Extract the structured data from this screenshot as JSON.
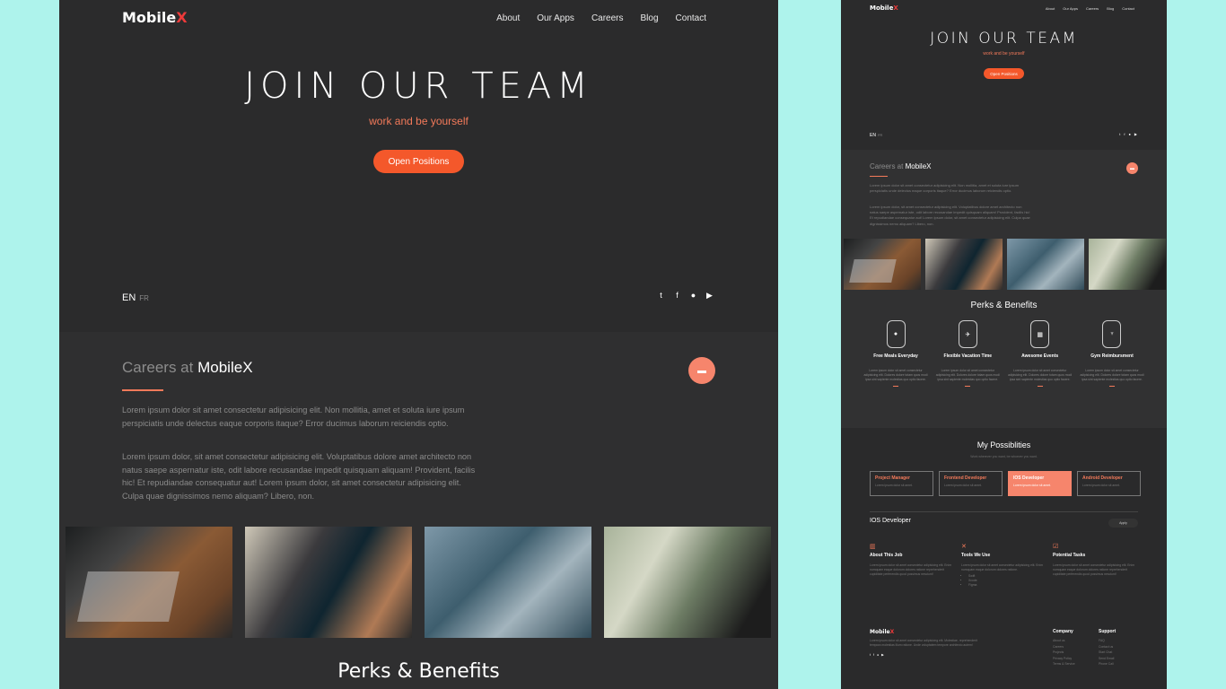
{
  "brand": {
    "name": "Mobile",
    "accent": "X",
    "accent_color": "#ee3a3a"
  },
  "colors": {
    "primary": "#f4582b",
    "soft": "#f6856c",
    "bg": "#2a2a2b",
    "page_bg": "#aef3ec"
  },
  "nav": [
    "About",
    "Our Apps",
    "Careers",
    "Blog",
    "Contact"
  ],
  "hero": {
    "title": "JOIN OUR TEAM",
    "subtitle": "work and be yourself",
    "button": "Open Positions"
  },
  "lang": {
    "active": "EN",
    "other": "FR"
  },
  "social": [
    {
      "icon": "twitter-icon",
      "glyph": "🐦"
    },
    {
      "icon": "facebook-icon",
      "glyph": "f"
    },
    {
      "icon": "apple-icon",
      "glyph": ""
    },
    {
      "icon": "play-store-icon",
      "glyph": "▶"
    }
  ],
  "careers": {
    "heading_prefix": "Careers at",
    "heading_brand": "MobileX",
    "p1": "Lorem ipsum dolor sit amet consectetur adipisicing elit. Non mollitia, amet et soluta iure ipsum perspiciatis unde delectus eaque corporis itaque? Error ducimus laborum reiciendis optio.",
    "p2": "Lorem ipsum dolor, sit amet consectetur adipisicing elit. Voluptatibus dolore amet architecto non natus saepe aspernatur iste, odit labore recusandae impedit quisquam aliquam! Provident, facilis hic! Et repudiandae consequatur aut! Lorem ipsum dolor, sit amet consectetur adipisicing elit. Culpa quae dignissimos nemo aliquam? Libero, non.",
    "photos": [
      "laptop-coffee-photo",
      "phone-laptop-photo",
      "typing-laptop-photo",
      "man-phone-photo"
    ]
  },
  "perks": {
    "title": "Perks & Benefits",
    "items": [
      {
        "icon": "apple-icon",
        "glyph": "",
        "title": "Free Meals Everyday"
      },
      {
        "icon": "vacation-icon",
        "glyph": "✈",
        "title": "Flexible Vacation Time"
      },
      {
        "icon": "calendar-icon",
        "glyph": "▦",
        "title": "Awesome Events"
      },
      {
        "icon": "gym-icon",
        "glyph": "♆",
        "title": "Gym Reimbursment"
      }
    ],
    "desc": "Lorem ipsum dolor sit amet consectetur adipisicing elit. Dolores dolore totam quos modi ipsa sint sapiente molestias quo optio facere."
  },
  "possibilities": {
    "title": "My Possiblities",
    "subtitle": "Work wherever you want, be whoever you want.",
    "roles": [
      {
        "title": "Project Manager",
        "desc": "Lorem ipsum dolor sit amet."
      },
      {
        "title": "Frontend Developer",
        "desc": "Lorem ipsum dolor sit amet."
      },
      {
        "title": "IOS Developer",
        "desc": "Lorem ipsum dolor sit amet."
      },
      {
        "title": "Android Developer",
        "desc": "Lorem ipsum dolor sit amet."
      }
    ],
    "active_index": 2,
    "job_title": "IOS Developer",
    "apply": "Apply",
    "columns": [
      {
        "icon": "briefcase-icon",
        "glyph": "▥",
        "title": "About This Job",
        "desc": "Lorem ipsum dolor sit amet consectetur adipisicing elit. Enim numquam eaque dolorum dolores ratione reprehenderit cupiditate perferendis quod possimus nesciunt!"
      },
      {
        "icon": "tools-icon",
        "glyph": "✕",
        "title": "Tools We Use",
        "desc": "Lorem ipsum dolor sit amet consectetur adipisicing elit. Enim numquam eaque dolorum dolores ratione.",
        "list": [
          "Swift",
          "Xcode",
          "Figma"
        ]
      },
      {
        "icon": "checklist-icon",
        "glyph": "☑",
        "title": "Potential Tasks",
        "desc": "Lorem ipsum dolor sit amet consectetur adipisicing elit. Enim numquam eaque dolorum dolores ratione reprehenderit cupiditate perferendis quod possimus nesciunt!"
      }
    ]
  },
  "footer": {
    "desc": "Lorem ipsum dolor sit amet consectetur adipisicing elit. Molestiae, reprehenderit tempora molestias illum ratione. Unde voluptatem tempore architecto autem!",
    "company": {
      "title": "Company",
      "links": [
        "About us",
        "Careers",
        "Projects",
        "Privacy Policy",
        "Terms & Service"
      ]
    },
    "support": {
      "title": "Support",
      "links": [
        "FAQ",
        "Contact us",
        "Start Chat",
        "Send Email",
        "Phone Call"
      ]
    }
  }
}
